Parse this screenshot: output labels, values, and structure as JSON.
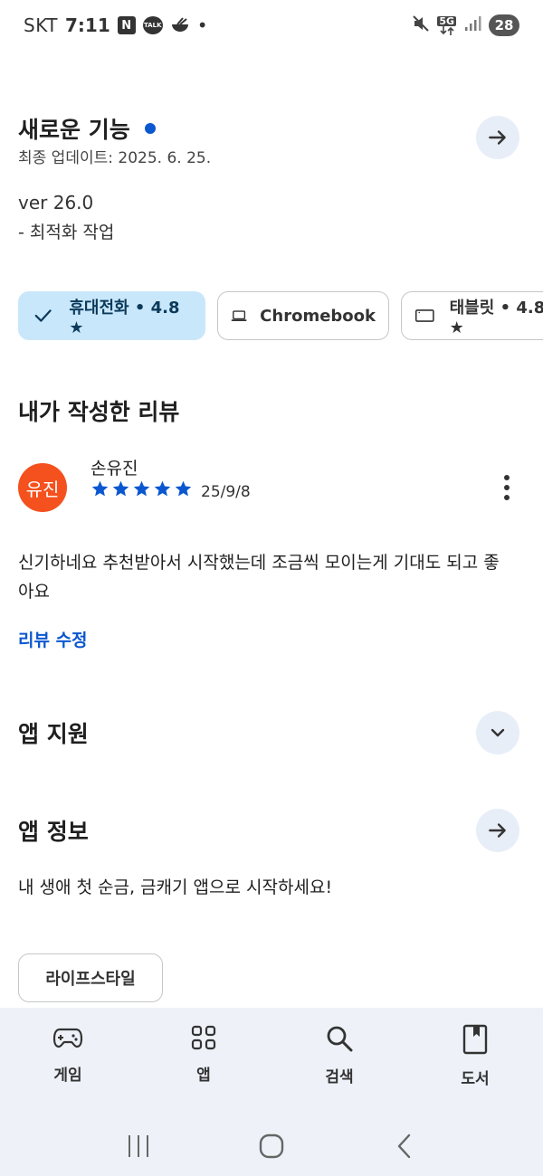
{
  "status_bar": {
    "carrier": "SKT",
    "time": "7:11",
    "notif_n": "N",
    "notif_talk": "TALK",
    "dot": "•",
    "network": "5G",
    "battery": "28"
  },
  "whats_new": {
    "title": "새로운 기능",
    "updated": "최종 업데이트: 2025. 6. 25.",
    "version": "ver 26.0",
    "note": "- 최적화 작업"
  },
  "device_chips": [
    {
      "label": "휴대전화 • 4.8 ★",
      "icon": "check-icon",
      "selected": true
    },
    {
      "label": "Chromebook",
      "icon": "laptop-icon",
      "selected": false
    },
    {
      "label": "태블릿 • 4.8 ★",
      "icon": "tablet-icon",
      "selected": false
    }
  ],
  "my_review": {
    "title": "내가 작성한 리뷰",
    "avatar_text": "유진",
    "reviewer": "손유진",
    "rating": 5,
    "date": "25/9/8",
    "text": "신기하네요 추천받아서 시작했는데 조금씩 모이는게 기대도 되고 좋아요",
    "edit_label": "리뷰 수정"
  },
  "app_support": {
    "title": "앱 지원"
  },
  "app_info": {
    "title": "앱 정보",
    "description": "내 생애 첫 순금, 금캐기 앱으로 시작하세요!",
    "category": "라이프스타일"
  },
  "bottom_nav": [
    {
      "label": "게임",
      "icon": "gamepad-icon"
    },
    {
      "label": "앱",
      "icon": "apps-grid-icon"
    },
    {
      "label": "검색",
      "icon": "search-icon"
    },
    {
      "label": "도서",
      "icon": "book-icon"
    }
  ],
  "colors": {
    "accent": "#0b57d0",
    "chip_selected": "#c9e7fb",
    "avatar": "#f4511e",
    "nav_bg": "#eef2f8"
  }
}
